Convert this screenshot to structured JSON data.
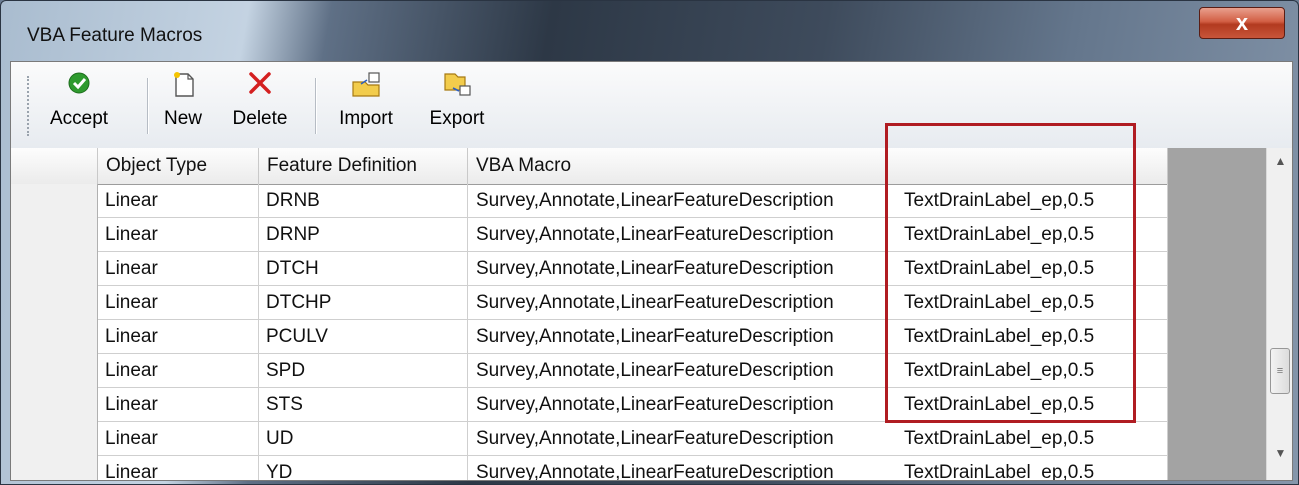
{
  "window": {
    "title": "VBA Feature Macros",
    "close_glyph": "x"
  },
  "toolbar": {
    "buttons": [
      {
        "label": "Accept",
        "icon": "green-check-icon"
      },
      {
        "label": "New",
        "icon": "new-document-icon"
      },
      {
        "label": "Delete",
        "icon": "red-x-icon"
      },
      {
        "label": "Import",
        "icon": "import-folder-icon"
      },
      {
        "label": "Export",
        "icon": "export-folder-icon"
      }
    ]
  },
  "grid": {
    "columns": [
      "Object Type",
      "Feature Definition",
      "VBA Macro"
    ],
    "rows": [
      {
        "object_type": "Linear",
        "feature_definition": "DRNB",
        "vba_macro": "Survey,Annotate,LinearFeatureDescription",
        "args": "TextDrainLabel_ep,0.5"
      },
      {
        "object_type": "Linear",
        "feature_definition": "DRNP",
        "vba_macro": "Survey,Annotate,LinearFeatureDescription",
        "args": "TextDrainLabel_ep,0.5"
      },
      {
        "object_type": "Linear",
        "feature_definition": "DTCH",
        "vba_macro": "Survey,Annotate,LinearFeatureDescription",
        "args": "TextDrainLabel_ep,0.5"
      },
      {
        "object_type": "Linear",
        "feature_definition": "DTCHP",
        "vba_macro": "Survey,Annotate,LinearFeatureDescription",
        "args": "TextDrainLabel_ep,0.5"
      },
      {
        "object_type": "Linear",
        "feature_definition": "PCULV",
        "vba_macro": "Survey,Annotate,LinearFeatureDescription",
        "args": "TextDrainLabel_ep,0.5"
      },
      {
        "object_type": "Linear",
        "feature_definition": "SPD",
        "vba_macro": "Survey,Annotate,LinearFeatureDescription",
        "args": "TextDrainLabel_ep,0.5"
      },
      {
        "object_type": "Linear",
        "feature_definition": "STS",
        "vba_macro": "Survey,Annotate,LinearFeatureDescription",
        "args": "TextDrainLabel_ep,0.5"
      },
      {
        "object_type": "Linear",
        "feature_definition": "UD",
        "vba_macro": "Survey,Annotate,LinearFeatureDescription",
        "args": "TextDrainLabel_ep,0.5"
      },
      {
        "object_type": "Linear",
        "feature_definition": "YD",
        "vba_macro": "Survey,Annotate,LinearFeatureDescription",
        "args": "TextDrainLabel_ep,0.5"
      }
    ]
  },
  "colors": {
    "highlight": "#b01c22",
    "accept_green": "#2e9a2e",
    "delete_red": "#d42020"
  }
}
